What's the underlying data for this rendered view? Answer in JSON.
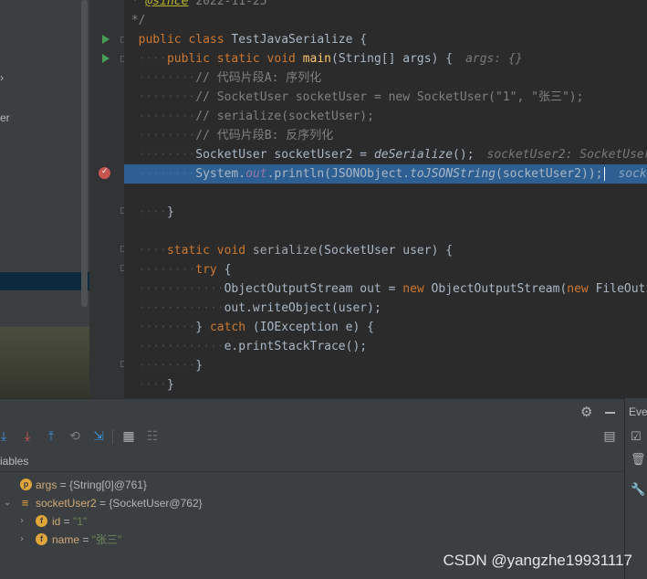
{
  "project_tree": {
    "fragment": "er"
  },
  "editor": {
    "lines": {
      "l0a": "* ",
      "l0b": "@since",
      "l0c": " 2022-11-25",
      "l1": "*/",
      "l2kw": "public class ",
      "l2id": "TestJavaSerialize {",
      "l3kw": "public static void ",
      "l3fn": "main",
      "l3rest": "(String[] args) {",
      "l3hint": "args: {}",
      "l4": "// 代码片段A: 序列化",
      "l5a": "// SocketUser socketUser = ",
      "l5b": "new",
      "l5c": " SocketUser(\"1\", \"张三\");",
      "l6": "// serialize(socketUser);",
      "l7": "// 代码片段B: 反序列化",
      "l8a": "SocketUser socketUser2 = ",
      "l8b": "deSerialize",
      "l8c": "();",
      "l8hint": "socketUser2: SocketUser",
      "l9a": "System.",
      "l9b": "out",
      "l9c": ".println(JSONObject.",
      "l9d": "toJSONString",
      "l9e": "(socketUser2));",
      "l9hint": "sock",
      "l11": "}",
      "l13kw": "static void ",
      "l13fn": "serialize",
      "l13rest": "(SocketUser user) {",
      "l14": "try",
      "l15a": "ObjectOutputStream out = ",
      "l15b": "new",
      "l15c": " ObjectOutputStream(",
      "l15d": "new",
      "l15e": " FileOut",
      "l16": "out.writeObject(user);",
      "l17a": "} ",
      "l17b": "catch",
      "l17c": " (IOException e) {",
      "l18": "e.printStackTrace();",
      "l19": "}",
      "l20": "}"
    }
  },
  "debugger": {
    "right_tab_label": "Eve",
    "variables_title": "iables",
    "variables": [
      {
        "name": "args",
        "value": "{String[0]@761}",
        "badge": "p"
      },
      {
        "name": "socketUser2",
        "value": "{SocketUser@762}",
        "badge": "≡"
      },
      {
        "name": "id",
        "value": "\"1\"",
        "badge": "f"
      },
      {
        "name": "name",
        "value": "\"张三\"",
        "badge": "f"
      }
    ],
    "equals": " = "
  },
  "watermark": "CSDN @yangzhe19931117",
  "colors": {
    "accent": "#2d5f92",
    "keyword": "#cc7832",
    "function": "#ffc66d",
    "string": "#6a8759",
    "comment": "#808080"
  }
}
